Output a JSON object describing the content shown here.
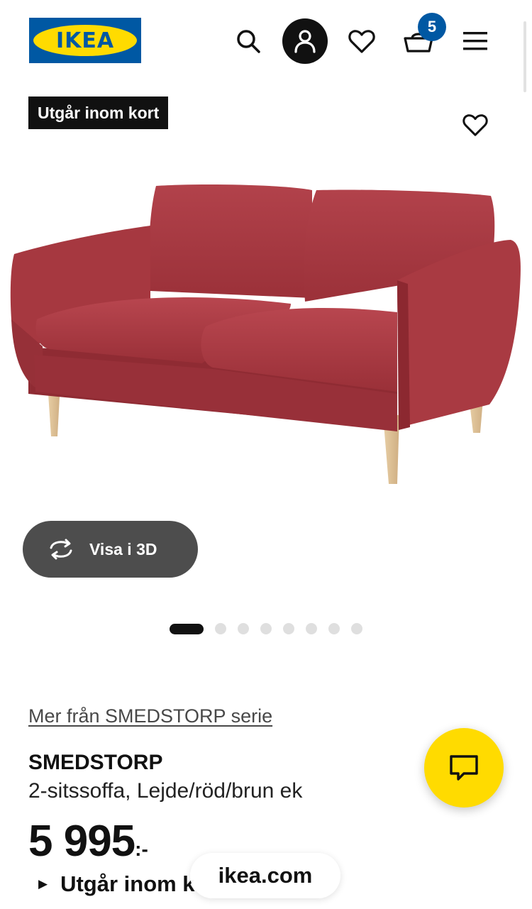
{
  "header": {
    "logo_text": "IKEA",
    "cart_count": "5",
    "icons": [
      "search-icon",
      "account-icon",
      "heart-icon",
      "cart-icon",
      "menu-icon"
    ]
  },
  "product_image": {
    "badge": "Utgår inom kort",
    "view_3d_label": "Visa i 3D",
    "carousel": {
      "total": 8,
      "active": 1
    }
  },
  "product": {
    "series_link": "Mer från SMEDSTORP serie",
    "name": "SMEDSTORP",
    "description": "2-sitssoffa, Lejde/röd/brun ek",
    "price_integer": "5 995",
    "price_suffix": ":-",
    "status": "Utgår inom k"
  },
  "browser": {
    "domain": "ikea.com"
  },
  "colors": {
    "brand_blue": "#0058a3",
    "brand_yellow": "#ffdb00",
    "badge_dark": "#111111",
    "button_grey": "#4d4d4d",
    "sofa_red": "#a8383f"
  }
}
